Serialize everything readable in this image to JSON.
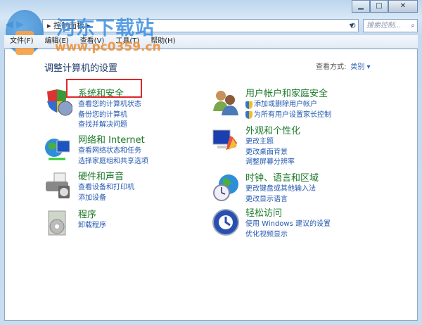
{
  "window": {
    "minimize": "▁",
    "maximize": "□",
    "close": "✕"
  },
  "address": {
    "path": "▸ 控制面板 ▸",
    "search_placeholder": "搜索控制...",
    "search_icon": "⌕",
    "refresh_icon": "⟲",
    "nav": "◀ ▶"
  },
  "menu": [
    "文件(F)",
    "编辑(E)",
    "查看(V)",
    "工具(T)",
    "帮助(H)"
  ],
  "watermark": {
    "name": "河东下载站",
    "url": "www.pc0359.cn"
  },
  "header": {
    "title": "调整计算机的设置",
    "view_label": "查看方式:",
    "view_value": "类别 ▾"
  },
  "categories": [
    {
      "title": "系统和安全",
      "icon": "shield-icon",
      "links": [
        "查看您的计算机状态",
        "备份您的计算机",
        "查找并解决问题"
      ]
    },
    {
      "title": "网络和 Internet",
      "icon": "network-globe-icon",
      "links": [
        "查看网络状态和任务",
        "选择家庭组和共享选项"
      ]
    },
    {
      "title": "硬件和声音",
      "icon": "printer-icon",
      "links": [
        "查看设备和打印机",
        "添加设备"
      ]
    },
    {
      "title": "程序",
      "icon": "programs-icon",
      "links": [
        "卸载程序"
      ]
    },
    {
      "title": "用户帐户和家庭安全",
      "icon": "users-icon",
      "links": [
        "添加或删除用户帐户",
        "为所有用户设置家长控制"
      ]
    },
    {
      "title": "外观和个性化",
      "icon": "monitor-palette-icon",
      "links": [
        "更改主题",
        "更改桌面背景",
        "调整屏幕分辨率"
      ]
    },
    {
      "title": "时钟、语言和区域",
      "icon": "globe-clock-icon",
      "links": [
        "更改键盘或其他输入法",
        "更改显示语言"
      ]
    },
    {
      "title": "轻松访问",
      "icon": "ease-of-access-icon",
      "links": [
        "使用 Windows 建议的设置",
        "优化视频显示"
      ]
    }
  ]
}
